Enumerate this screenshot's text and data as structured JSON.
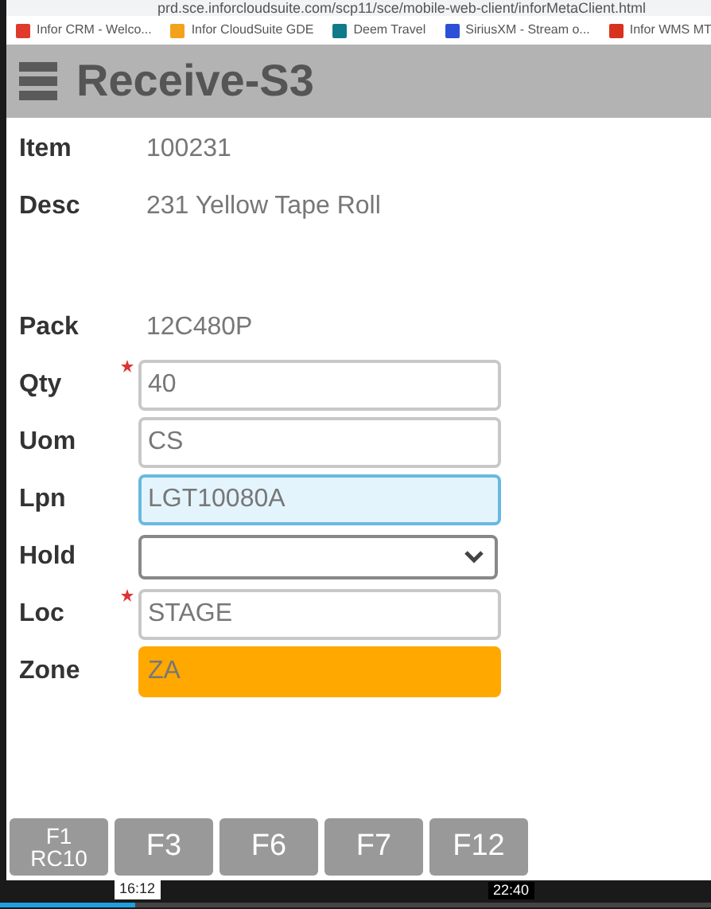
{
  "browser": {
    "url": "prd.sce.inforcloudsuite.com/scp11/sce/mobile-web-client/inforMetaClient.html",
    "bookmarks": [
      {
        "label": "Infor CRM - Welco...",
        "color": "#e03a2a"
      },
      {
        "label": "Infor CloudSuite GDE",
        "color": "#f2a31b"
      },
      {
        "label": "Deem Travel",
        "color": "#0f7b8a"
      },
      {
        "label": "SiriusXM - Stream o...",
        "color": "#2b4fd6"
      },
      {
        "label": "Infor WMS MT",
        "color": "#d8321f"
      }
    ]
  },
  "app": {
    "title": "Receive-S3",
    "fields": [
      {
        "kind": "info",
        "label": "Item",
        "value": "100231"
      },
      {
        "kind": "info",
        "label": "Desc",
        "value": "231 Yellow Tape Roll"
      },
      {
        "kind": "gap"
      },
      {
        "kind": "info",
        "label": "Pack",
        "value": "12C480P"
      },
      {
        "kind": "input",
        "label": "Qty",
        "value": "40",
        "required": true,
        "focused": false
      },
      {
        "kind": "input",
        "label": "Uom",
        "value": "CS",
        "required": false,
        "focused": false
      },
      {
        "kind": "input",
        "label": "Lpn",
        "value": "LGT10080A",
        "required": false,
        "focused": true
      },
      {
        "kind": "select",
        "label": "Hold",
        "required": false,
        "focused": false
      },
      {
        "kind": "input",
        "label": "Loc",
        "value": "STAGE",
        "required": true,
        "focused": false
      },
      {
        "kind": "input",
        "label": "Zone",
        "value": "ZA",
        "required": false,
        "focused": false,
        "color": "#ffa800"
      }
    ],
    "keys": [
      [
        "F1",
        "RC10"
      ],
      [
        "F3"
      ],
      [
        "F6"
      ],
      [
        "F7"
      ],
      [
        "F12"
      ]
    ]
  },
  "player": {
    "hover_time": "16:12",
    "duration": "22:40",
    "level": 0.19
  }
}
